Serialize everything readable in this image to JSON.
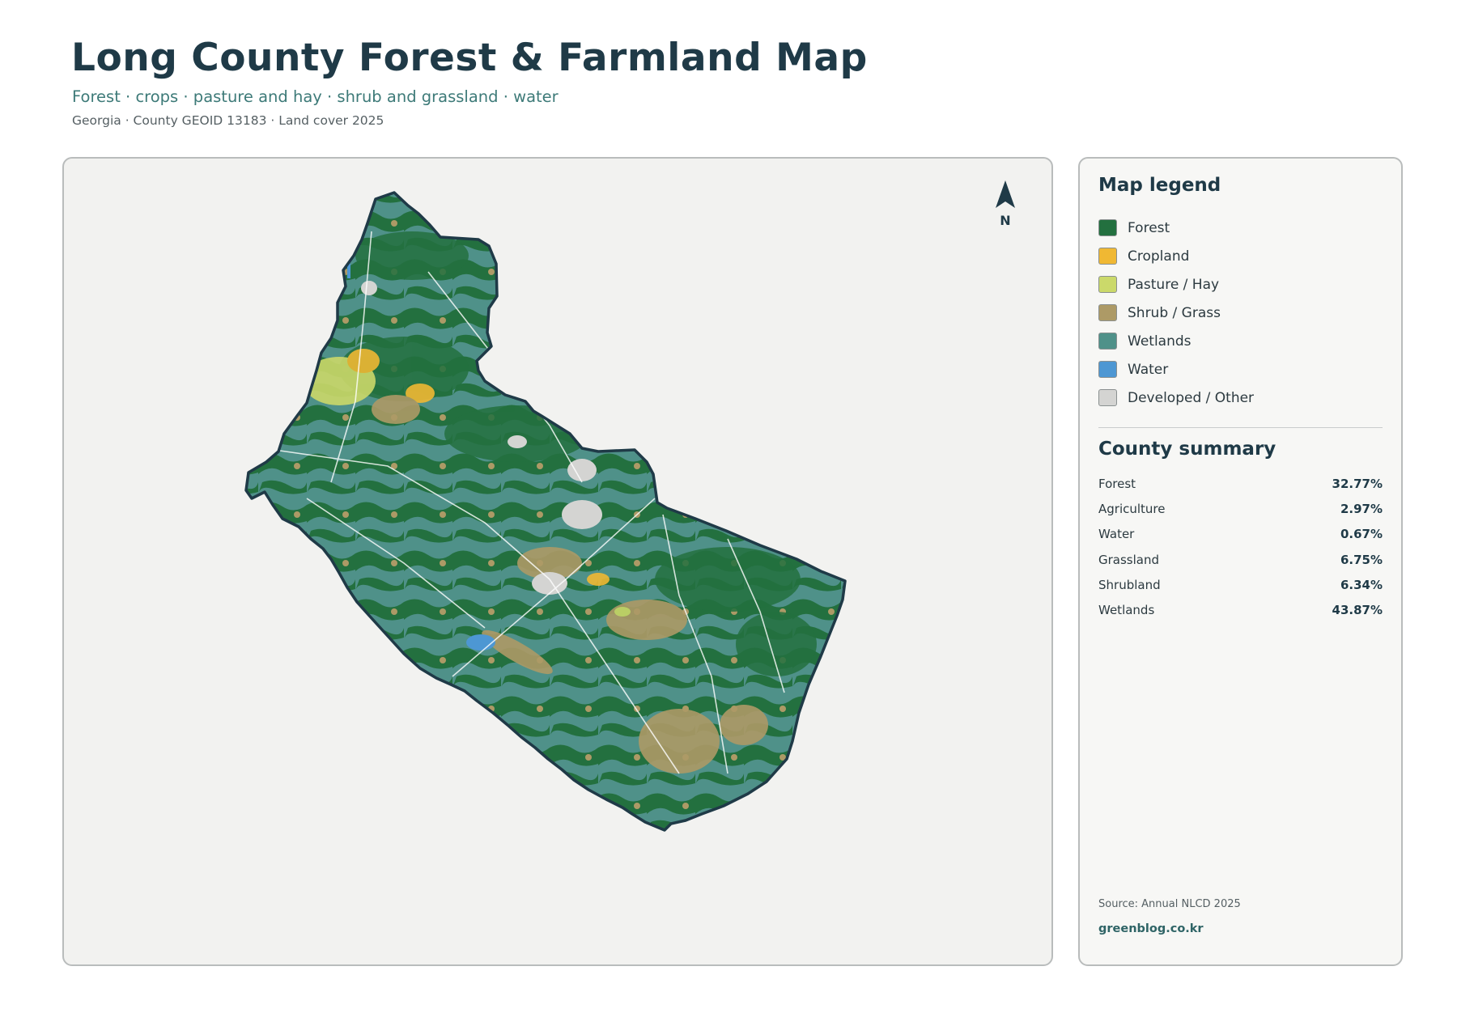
{
  "header": {
    "title": "Long County Forest & Farmland Map",
    "subtitle": "Forest · crops · pasture and hay · shrub and grassland · water",
    "meta": "Georgia · County GEOID 13183 · Land cover 2025"
  },
  "map": {
    "north_label": "N",
    "colors": {
      "forest": "#23703f",
      "cropland": "#f0b833",
      "pasture": "#cbd96a",
      "shrub": "#ad9a66",
      "wetlands": "#4f9189",
      "water": "#4d97d3",
      "developed": "#d4d4d2",
      "outline": "#1f3a47"
    }
  },
  "legend": {
    "heading": "Map legend",
    "items": [
      {
        "label": "Forest",
        "color": "#23703f"
      },
      {
        "label": "Cropland",
        "color": "#f0b833"
      },
      {
        "label": "Pasture / Hay",
        "color": "#cbd96a"
      },
      {
        "label": "Shrub / Grass",
        "color": "#ad9a66"
      },
      {
        "label": "Wetlands",
        "color": "#4f9189"
      },
      {
        "label": "Water",
        "color": "#4d97d3"
      },
      {
        "label": "Developed / Other",
        "color": "#d4d4d2"
      }
    ]
  },
  "summary": {
    "heading": "County summary",
    "rows": [
      {
        "label": "Forest",
        "value": "32.77%"
      },
      {
        "label": "Agriculture",
        "value": "2.97%"
      },
      {
        "label": "Water",
        "value": "0.67%"
      },
      {
        "label": "Grassland",
        "value": "6.75%"
      },
      {
        "label": "Shrubland",
        "value": "6.34%"
      },
      {
        "label": "Wetlands",
        "value": "43.87%"
      }
    ]
  },
  "footer": {
    "source": "Source: Annual NLCD 2025",
    "site": "greenblog.co.kr"
  }
}
